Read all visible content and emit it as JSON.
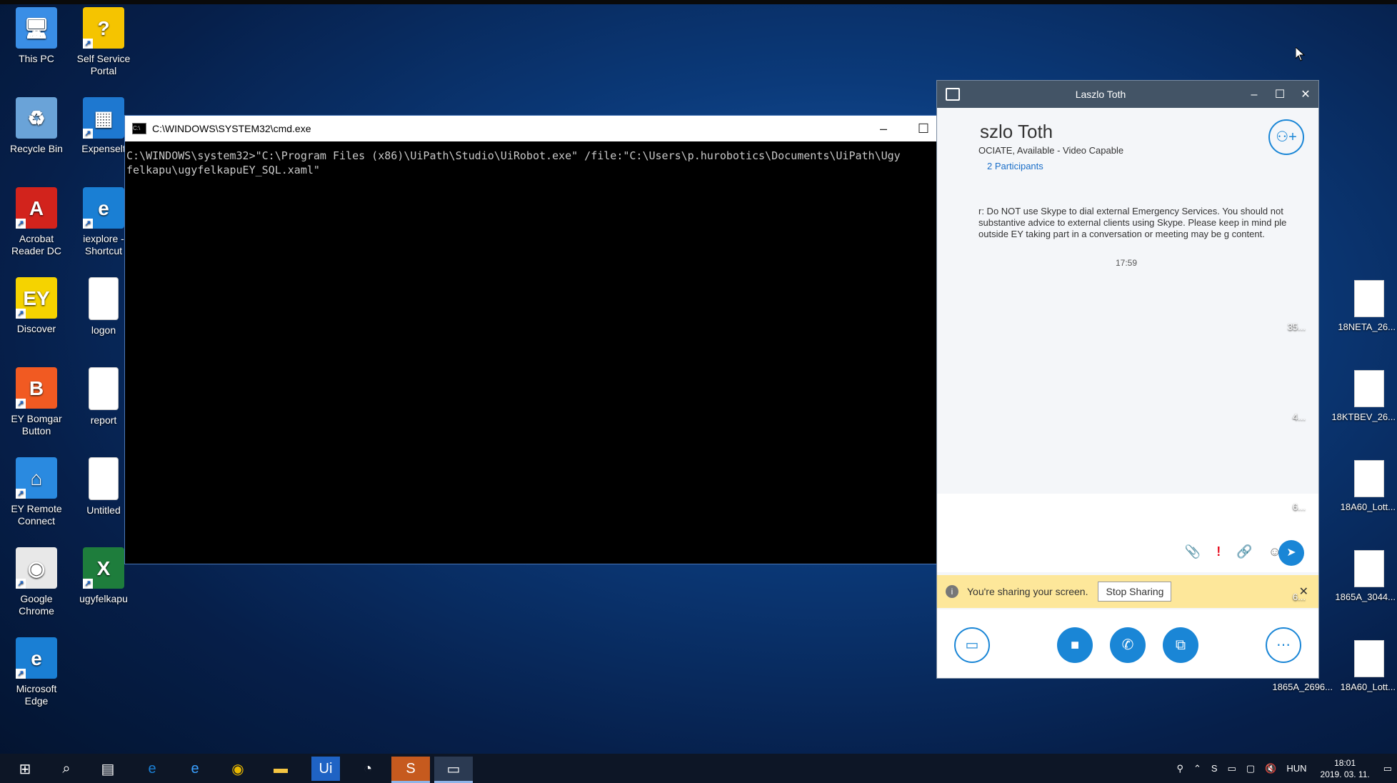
{
  "desktop": {
    "icons": [
      {
        "label": "This PC",
        "color": "#3a8ee6",
        "glyph": "🖥"
      },
      {
        "label": "Self Service Portal",
        "color": "#f5c400",
        "glyph": "?"
      },
      {
        "label": "Recycle Bin",
        "color": "#6aa3d8",
        "glyph": "♻"
      },
      {
        "label": "Expenselt",
        "color": "#1e78d0",
        "glyph": "▦"
      },
      {
        "label": "Acrobat Reader DC",
        "color": "#d2231c",
        "glyph": "A"
      },
      {
        "label": "iexplore - Shortcut",
        "color": "#1a7fd4",
        "glyph": "e"
      },
      {
        "label": "Discover",
        "color": "#f5d300",
        "glyph": "EY"
      },
      {
        "label": "logon",
        "color": "#ffffff",
        "glyph": ""
      },
      {
        "label": "EY Bomgar Button",
        "color": "#f15a22",
        "glyph": "B"
      },
      {
        "label": "report",
        "color": "#ffffff",
        "glyph": ""
      },
      {
        "label": "EY Remote Connect",
        "color": "#2a8ae0",
        "glyph": "⌂"
      },
      {
        "label": "Untitled",
        "color": "#ffffff",
        "glyph": ""
      },
      {
        "label": "Google Chrome",
        "color": "#e8e8e8",
        "glyph": "◉"
      },
      {
        "label": "ugyfelkapu",
        "color": "#1e7d3c",
        "glyph": "X"
      },
      {
        "label": "Microsoft Edge",
        "color": "#1a7fd4",
        "glyph": "e"
      }
    ],
    "right_files": [
      {
        "label_a": "35...",
        "label_b": "18NETA_26..."
      },
      {
        "label_a": "4...",
        "label_b": "18KTBEV_26..."
      },
      {
        "label_a": "6...",
        "label_b": "18A60_Lott..."
      },
      {
        "label_a": "6...",
        "label_b": "1865A_3044..."
      },
      {
        "label_a": "1865A_2696...",
        "label_b": "18A60_Lott..."
      }
    ]
  },
  "cmd": {
    "title": "C:\\WINDOWS\\SYSTEM32\\cmd.exe",
    "line1": "C:\\WINDOWS\\system32>\"C:\\Program Files (x86)\\UiPath\\Studio\\UiRobot.exe\" /file:\"C:\\Users\\p.hurobotics\\Documents\\UiPath\\Ugy",
    "line2": "felkapu\\ugyfelkapuEY_SQL.xaml\"",
    "minimize": "–",
    "maximize": "☐",
    "close": "✕"
  },
  "skype": {
    "title": "Laszlo Toth",
    "name": "szlo Toth",
    "status": "OCIATE,  Available - Video Capable",
    "participants": "2 Participants",
    "disclaimer": "r: Do NOT use Skype to dial external Emergency Services. You should not substantive advice to external clients using Skype. Please keep in mind ple outside EY taking part in a conversation or meeting may be g content.",
    "time": "17:59",
    "sharing_text": "You're sharing your screen.",
    "stop_sharing": "Stop Sharing",
    "colors": {
      "accent": "#1a86d6",
      "titlebar": "#435466",
      "share_bar": "#fde79a"
    }
  },
  "taskbar": {
    "language": "HUN",
    "time": "18:01",
    "date": "2019. 03. 11."
  }
}
